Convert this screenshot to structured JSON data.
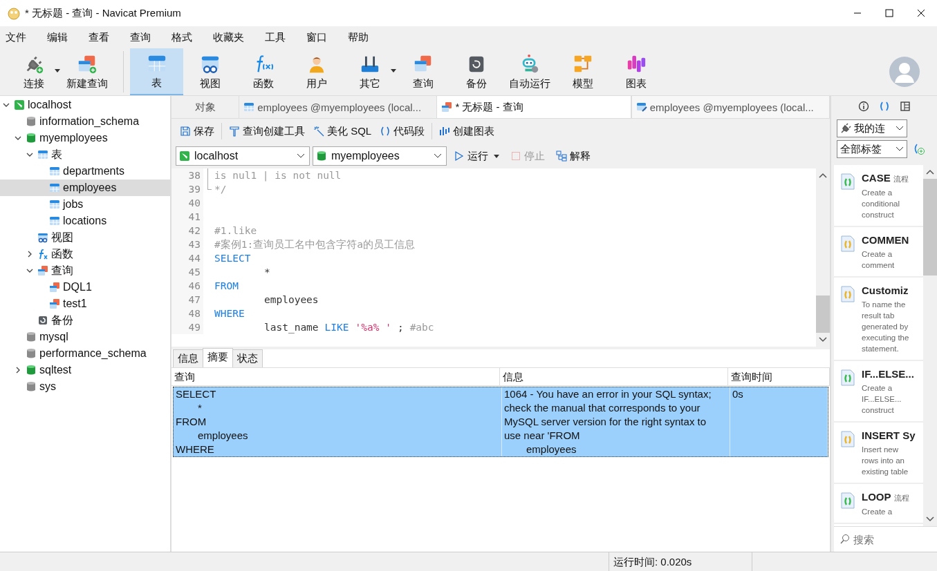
{
  "window": {
    "title": "* 无标题 - 查询 - Navicat Premium"
  },
  "menu": [
    "文件",
    "编辑",
    "查看",
    "查询",
    "格式",
    "收藏夹",
    "工具",
    "窗口",
    "帮助"
  ],
  "toolbar": [
    {
      "label": "连接",
      "kind": "connect",
      "dropdown": true,
      "selected": false
    },
    {
      "label": "新建查询",
      "kind": "newquery",
      "dropdown": false,
      "selected": false
    },
    {
      "label": "表",
      "kind": "table",
      "dropdown": false,
      "selected": true
    },
    {
      "label": "视图",
      "kind": "view",
      "dropdown": false,
      "selected": false
    },
    {
      "label": "函数",
      "kind": "function",
      "dropdown": false,
      "selected": false
    },
    {
      "label": "用户",
      "kind": "user",
      "dropdown": false,
      "selected": false
    },
    {
      "label": "其它",
      "kind": "tools",
      "dropdown": true,
      "selected": false
    },
    {
      "label": "查询",
      "kind": "query",
      "dropdown": false,
      "selected": false
    },
    {
      "label": "备份",
      "kind": "backup",
      "dropdown": false,
      "selected": false
    },
    {
      "label": "自动运行",
      "kind": "robot",
      "dropdown": false,
      "selected": false
    },
    {
      "label": "模型",
      "kind": "model",
      "dropdown": false,
      "selected": false
    },
    {
      "label": "图表",
      "kind": "chart",
      "dropdown": false,
      "selected": false
    }
  ],
  "tree": [
    {
      "label": "localhost",
      "kind": "server",
      "expanded": true,
      "selected": false,
      "children": [
        {
          "label": "information_schema",
          "kind": "db",
          "selected": false
        },
        {
          "label": "myemployees",
          "kind": "db-open",
          "expanded": true,
          "selected": false,
          "children": [
            {
              "label": "表",
              "kind": "table",
              "expanded": true,
              "selected": false,
              "children": [
                {
                  "label": "departments",
                  "kind": "table",
                  "selected": false
                },
                {
                  "label": "employees",
                  "kind": "table",
                  "selected": true
                },
                {
                  "label": "jobs",
                  "kind": "table",
                  "selected": false
                },
                {
                  "label": "locations",
                  "kind": "table",
                  "selected": false
                }
              ]
            },
            {
              "label": "视图",
              "kind": "view",
              "selected": false
            },
            {
              "label": "函数",
              "kind": "function",
              "expanded": false,
              "selected": false
            },
            {
              "label": "查询",
              "kind": "query",
              "expanded": true,
              "selected": false,
              "children": [
                {
                  "label": "DQL1",
                  "kind": "query",
                  "selected": false
                },
                {
                  "label": "test1",
                  "kind": "query",
                  "selected": false
                }
              ]
            },
            {
              "label": "备份",
              "kind": "backup",
              "selected": false
            }
          ]
        },
        {
          "label": "mysql",
          "kind": "db",
          "selected": false
        },
        {
          "label": "performance_schema",
          "kind": "db",
          "selected": false
        },
        {
          "label": "sqltest",
          "kind": "db-open",
          "expanded": false,
          "selected": false
        },
        {
          "label": "sys",
          "kind": "db",
          "selected": false
        }
      ]
    }
  ],
  "tabs": [
    {
      "label": "对象",
      "kind": "plain",
      "selected": false
    },
    {
      "label": "employees @myemployees (local...",
      "kind": "table",
      "selected": false
    },
    {
      "label": "* 无标题 - 查询",
      "kind": "query",
      "selected": true
    },
    {
      "label": "employees @myemployees (local...",
      "kind": "table-edit",
      "selected": false
    }
  ],
  "editor_toolbar": [
    {
      "label": "保存",
      "kind": "save"
    },
    {
      "label": "查询创建工具",
      "kind": "builder"
    },
    {
      "label": "美化 SQL",
      "kind": "beautify"
    },
    {
      "label": "代码段",
      "kind": "snippet"
    },
    {
      "label": "创建图表",
      "kind": "chart"
    }
  ],
  "connection_select": {
    "value": "localhost"
  },
  "database_select": {
    "value": "myemployees"
  },
  "run_button": {
    "label": "运行"
  },
  "stop_button": {
    "label": "停止",
    "disabled": true
  },
  "explain_button": {
    "label": "解释"
  },
  "code_lines": [
    {
      "number": "38",
      "kind": "fold-body",
      "tokens": [
        {
          "kind": "comment",
          "text": "is nul1 | is not null"
        }
      ]
    },
    {
      "number": "39",
      "kind": "fold-end",
      "tokens": [
        {
          "kind": "comment",
          "text": "*/"
        }
      ]
    },
    {
      "number": "40"
    },
    {
      "number": "41"
    },
    {
      "number": "42",
      "tokens": [
        {
          "kind": "comment",
          "text": "#1.like"
        }
      ]
    },
    {
      "number": "43",
      "tokens": [
        {
          "kind": "comment",
          "text": "#案例1:查询员工名中包含字符a的员工信息"
        }
      ]
    },
    {
      "number": "44",
      "tokens": [
        {
          "kind": "keyword",
          "text": "SELECT"
        }
      ]
    },
    {
      "number": "45",
      "indent": true,
      "tokens": [
        {
          "kind": "plain",
          "text": "*"
        }
      ]
    },
    {
      "number": "46",
      "tokens": [
        {
          "kind": "keyword",
          "text": "FROM"
        }
      ]
    },
    {
      "number": "47",
      "indent": true,
      "tokens": [
        {
          "kind": "plain",
          "text": "employees"
        }
      ]
    },
    {
      "number": "48",
      "tokens": [
        {
          "kind": "keyword",
          "text": "WHERE"
        }
      ]
    },
    {
      "number": "49",
      "indent": true,
      "tokens": [
        {
          "kind": "plain",
          "text": "last_name"
        },
        {
          "kind": "keyword",
          "text": "LIKE"
        },
        {
          "kind": "string",
          "text": "'%a% '"
        },
        {
          "kind": "plain",
          "text": ";"
        },
        {
          "kind": "comment",
          "text": "#abc"
        }
      ]
    }
  ],
  "result_tabs": [
    {
      "label": "信息",
      "selected": false
    },
    {
      "label": "摘要",
      "selected": true
    },
    {
      "label": "状态",
      "selected": false
    }
  ],
  "result_table": {
    "columns": [
      "查询",
      "信息",
      "查询时间"
    ],
    "rows": [
      {
        "selected": true,
        "cells": [
          [
            {
              "text": "SELECT",
              "indent": false
            },
            {
              "text": "*",
              "indent": true
            },
            {
              "text": "FROM",
              "indent": false
            },
            {
              "text": "employees",
              "indent": true
            },
            {
              "text": "WHERE",
              "indent": false
            }
          ],
          [
            {
              "text": "1064 - You have an error in your SQL syntax;",
              "indent": false
            },
            {
              "text": "check the manual that corresponds to your",
              "indent": false
            },
            {
              "text": "MySQL server version for the right syntax to",
              "indent": false
            },
            {
              "text": "use near 'FROM",
              "indent": false
            },
            {
              "text": "employees",
              "indent": true
            }
          ],
          [
            {
              "text": "0s",
              "indent": false
            }
          ]
        ]
      }
    ]
  },
  "status_bar": {
    "run_time": "运行时间: 0.020s"
  },
  "side_panel": {
    "tabs": [
      {
        "kind": "info",
        "selected": false
      },
      {
        "kind": "snippet",
        "selected": true
      },
      {
        "kind": "columns",
        "selected": false
      }
    ],
    "connection_select": {
      "value": "我的连"
    },
    "tag_select": {
      "value": "全部标签"
    },
    "snippets": [
      {
        "title": "CASE",
        "tag": "流程",
        "description": "Create a conditional construct",
        "color": "#3cba54"
      },
      {
        "title": "COMMEN",
        "description": "Create a comment",
        "color": "#e8b630"
      },
      {
        "title": "Customiz",
        "description": "To name the result tab generated by executing the statement.",
        "color": "#e8b630"
      },
      {
        "title": "IF...ELSE...",
        "description": "Create a IF...ELSE... construct",
        "color": "#3cba54"
      },
      {
        "title": "INSERT Sy",
        "description": "Insert new rows into an existing table",
        "color": "#e8b630"
      },
      {
        "title": "LOOP",
        "tag": "流程",
        "description": "Create a",
        "color": "#3cba54"
      }
    ],
    "search": {
      "placeholder": "搜索"
    }
  }
}
